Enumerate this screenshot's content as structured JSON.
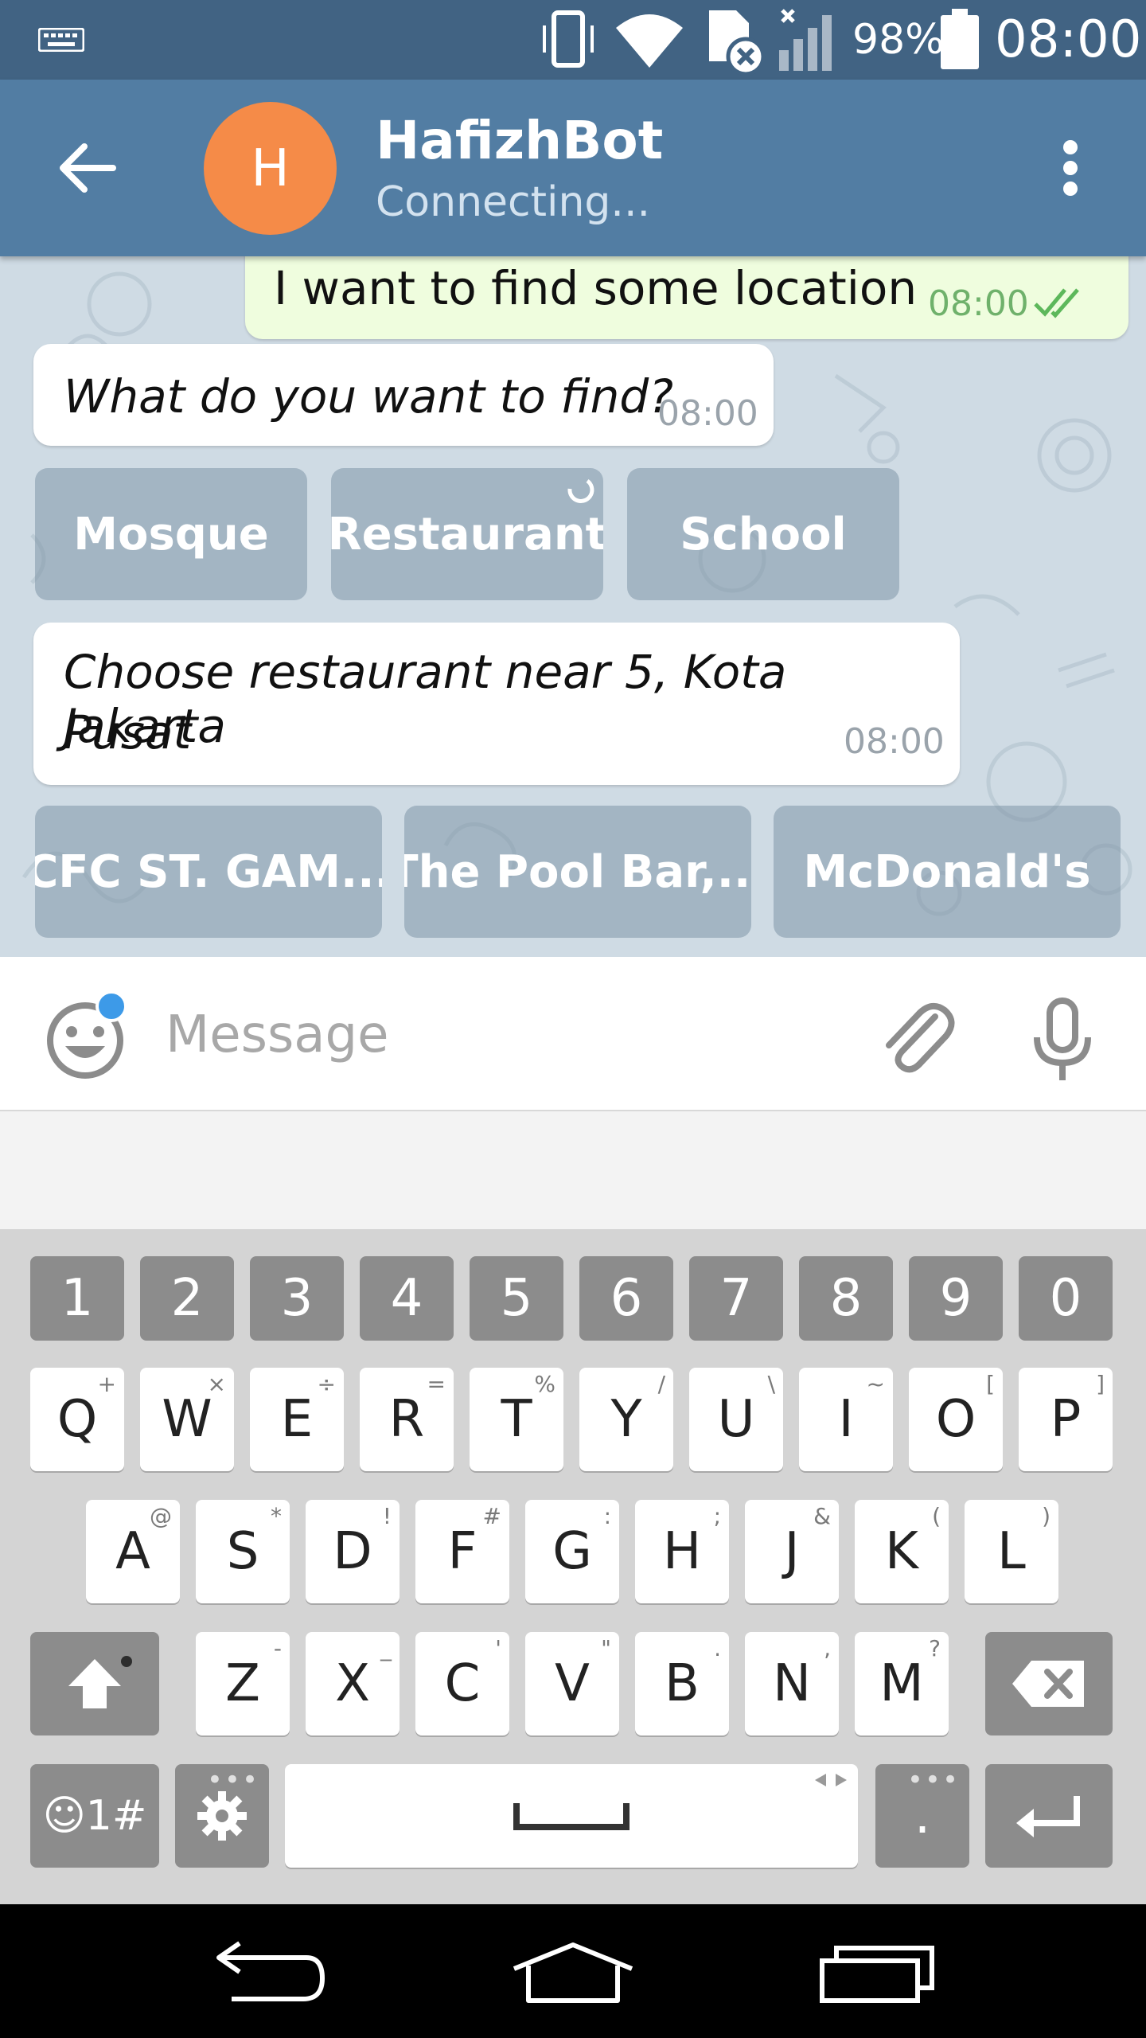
{
  "status_bar": {
    "battery_percent": "98%",
    "clock": "08:00",
    "icons": [
      "keyboard-icon",
      "vibrate-icon",
      "wifi-icon",
      "sim-error-icon",
      "signal-icon",
      "battery-icon"
    ]
  },
  "header": {
    "back_icon": "arrow-left-icon",
    "avatar_letter": "H",
    "avatar_color": "#f58b48",
    "title": "HafizhBot",
    "subtitle": "Connecting...",
    "menu_icon": "more-vertical-icon",
    "bar_color": "#527da3"
  },
  "chat": {
    "messages": [
      {
        "direction": "out",
        "text": "I want to find some location",
        "time": "08:00",
        "status_icon": "double-check-icon"
      },
      {
        "direction": "in",
        "text": "What do you want to find?",
        "time": "08:00"
      },
      {
        "direction": "in",
        "text_line1": "Choose restaurant near 5, Kota Jakarta",
        "text_line2": "Pusat",
        "time": "08:00"
      }
    ],
    "keyboard_row1": [
      "Mosque",
      "Restaurant",
      "School"
    ],
    "keyboard_row2": [
      "CFC ST. GAM...",
      "The Pool Bar,...",
      "McDonald's"
    ]
  },
  "composer": {
    "placeholder": "Message",
    "emoji_icon": "smiley-icon",
    "attach_icon": "paperclip-icon",
    "mic_icon": "microphone-icon"
  },
  "keyboard": {
    "numbers": [
      "1",
      "2",
      "3",
      "4",
      "5",
      "6",
      "7",
      "8",
      "9",
      "0"
    ],
    "row1": [
      {
        "k": "Q",
        "s": "+"
      },
      {
        "k": "W",
        "s": "×"
      },
      {
        "k": "E",
        "s": "÷"
      },
      {
        "k": "R",
        "s": "="
      },
      {
        "k": "T",
        "s": "%"
      },
      {
        "k": "Y",
        "s": "/"
      },
      {
        "k": "U",
        "s": "\\"
      },
      {
        "k": "I",
        "s": "~"
      },
      {
        "k": "O",
        "s": "["
      },
      {
        "k": "P",
        "s": "]"
      }
    ],
    "row2": [
      {
        "k": "A",
        "s": "@"
      },
      {
        "k": "S",
        "s": "*"
      },
      {
        "k": "D",
        "s": "!"
      },
      {
        "k": "F",
        "s": "#"
      },
      {
        "k": "G",
        "s": ":"
      },
      {
        "k": "H",
        "s": ";"
      },
      {
        "k": "J",
        "s": "&"
      },
      {
        "k": "K",
        "s": "("
      },
      {
        "k": "L",
        "s": ")"
      }
    ],
    "row3": [
      {
        "k": "Z",
        "s": "-"
      },
      {
        "k": "X",
        "s": "_"
      },
      {
        "k": "C",
        "s": "'"
      },
      {
        "k": "V",
        "s": "\""
      },
      {
        "k": "B",
        "s": "."
      },
      {
        "k": "N",
        "s": ","
      },
      {
        "k": "M",
        "s": "?"
      }
    ],
    "symbols_label": "☺1#",
    "period_label": ".",
    "shift_icon": "shift-arrow-icon",
    "backspace_icon": "backspace-icon",
    "settings_icon": "gear-icon",
    "space_icon": "space-bar-icon",
    "enter_icon": "enter-arrow-icon"
  },
  "nav_bar": {
    "icons": [
      "back-nav-icon",
      "home-nav-icon",
      "recents-nav-icon"
    ]
  }
}
